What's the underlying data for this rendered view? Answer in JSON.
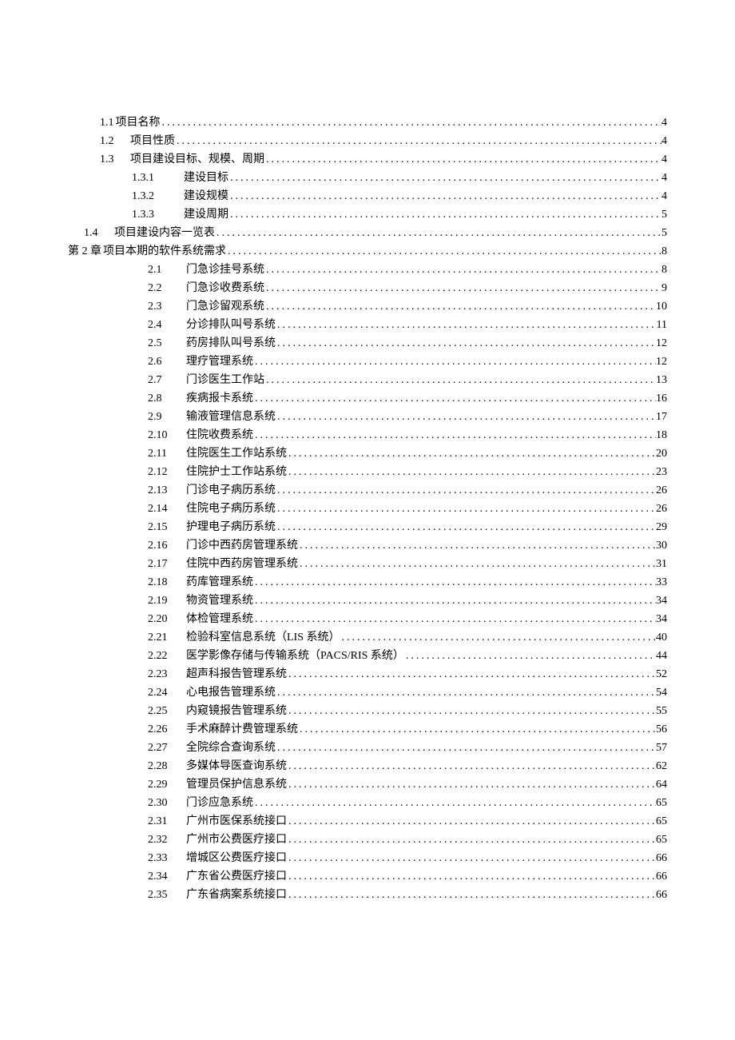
{
  "toc": [
    {
      "indent": "indent-1",
      "num": "1.1",
      "label": "项目名称",
      "page": "4",
      "tight": true
    },
    {
      "indent": "indent-1",
      "num": "1.2",
      "label": "项目性质",
      "page": "4"
    },
    {
      "indent": "indent-1",
      "num": "1.3",
      "label": "项目建设目标、规模、周期",
      "page": "4"
    },
    {
      "indent": "indent-2",
      "num": "1.3.1",
      "label": "建设目标",
      "page": "4"
    },
    {
      "indent": "indent-2",
      "num": "1.3.2",
      "label": "建设规模",
      "page": "4"
    },
    {
      "indent": "indent-2",
      "num": "1.3.3",
      "label": "建设周期",
      "page": "5"
    },
    {
      "indent": "indent-0",
      "num": "1.4",
      "label": "项目建设内容一览表",
      "page": "5",
      "numwidth": 38
    },
    {
      "indent": "indent-0a",
      "num": "第 2 章",
      "label": "项目本期的软件系统需求",
      "page": "8",
      "tight": true
    },
    {
      "indent": "indent-3",
      "num": "2.1",
      "label": "门急诊挂号系统",
      "page": "8"
    },
    {
      "indent": "indent-3",
      "num": "2.2",
      "label": "门急诊收费系统",
      "page": "9"
    },
    {
      "indent": "indent-3",
      "num": "2.3",
      "label": "门急诊留观系统",
      "page": "10"
    },
    {
      "indent": "indent-3",
      "num": "2.4",
      "label": "分诊排队叫号系统",
      "page": "11"
    },
    {
      "indent": "indent-3",
      "num": "2.5",
      "label": "药房排队叫号系统",
      "page": "12"
    },
    {
      "indent": "indent-3",
      "num": "2.6",
      "label": "理疗管理系统",
      "page": "12"
    },
    {
      "indent": "indent-3",
      "num": "2.7",
      "label": "门诊医生工作站",
      "page": "13"
    },
    {
      "indent": "indent-3",
      "num": "2.8",
      "label": "疾病报卡系统",
      "page": "16"
    },
    {
      "indent": "indent-3",
      "num": "2.9",
      "label": "输液管理信息系统",
      "page": "17"
    },
    {
      "indent": "indent-3",
      "num": "2.10",
      "label": "住院收费系统",
      "page": "18"
    },
    {
      "indent": "indent-3",
      "num": "2.11",
      "label": "住院医生工作站系统",
      "page": "20"
    },
    {
      "indent": "indent-3",
      "num": "2.12",
      "label": "住院护士工作站系统",
      "page": "23"
    },
    {
      "indent": "indent-3",
      "num": "2.13",
      "label": "门诊电子病历系统",
      "page": "26"
    },
    {
      "indent": "indent-3",
      "num": "2.14",
      "label": "住院电子病历系统",
      "page": "26"
    },
    {
      "indent": "indent-3",
      "num": "2.15",
      "label": "护理电子病历系统",
      "page": "29"
    },
    {
      "indent": "indent-3",
      "num": "2.16",
      "label": "门诊中西药房管理系统",
      "page": "30"
    },
    {
      "indent": "indent-3",
      "num": "2.17",
      "label": "住院中西药房管理系统",
      "page": "31"
    },
    {
      "indent": "indent-3",
      "num": "2.18",
      "label": "药库管理系统",
      "page": "33"
    },
    {
      "indent": "indent-3",
      "num": "2.19",
      "label": "物资管理系统",
      "page": "34"
    },
    {
      "indent": "indent-3",
      "num": "2.20",
      "label": "体检管理系统",
      "page": "34"
    },
    {
      "indent": "indent-3",
      "num": "2.21",
      "label": "检验科室信息系统（LIS 系统）",
      "page": "40"
    },
    {
      "indent": "indent-3",
      "num": "2.22",
      "label": "医学影像存储与传输系统（PACS/RIS 系统）",
      "page": "44"
    },
    {
      "indent": "indent-3",
      "num": "2.23",
      "label": "超声科报告管理系统",
      "page": "52"
    },
    {
      "indent": "indent-3",
      "num": "2.24",
      "label": "心电报告管理系统",
      "page": "54"
    },
    {
      "indent": "indent-3",
      "num": "2.25",
      "label": "内窥镜报告管理系统",
      "page": "55"
    },
    {
      "indent": "indent-3",
      "num": "2.26",
      "label": "手术麻醉计费管理系统",
      "page": "56"
    },
    {
      "indent": "indent-3",
      "num": "2.27",
      "label": "全院综合查询系统",
      "page": "57"
    },
    {
      "indent": "indent-3",
      "num": "2.28",
      "label": "多媒体导医查询系统",
      "page": "62"
    },
    {
      "indent": "indent-3",
      "num": "2.29",
      "label": "管理员保护信息系统",
      "page": "64"
    },
    {
      "indent": "indent-3",
      "num": "2.30",
      "label": "门诊应急系统",
      "page": "65"
    },
    {
      "indent": "indent-3",
      "num": "2.31",
      "label": "广州市医保系统接口",
      "page": "65"
    },
    {
      "indent": "indent-3",
      "num": "2.32",
      "label": "广州市公费医疗接口",
      "page": "65"
    },
    {
      "indent": "indent-3",
      "num": "2.33",
      "label": "增城区公费医疗接口",
      "page": "66"
    },
    {
      "indent": "indent-3",
      "num": "2.34",
      "label": "广东省公费医疗接口",
      "page": "66"
    },
    {
      "indent": "indent-3",
      "num": "2.35",
      "label": "广东省病案系统接口",
      "page": "66"
    }
  ]
}
